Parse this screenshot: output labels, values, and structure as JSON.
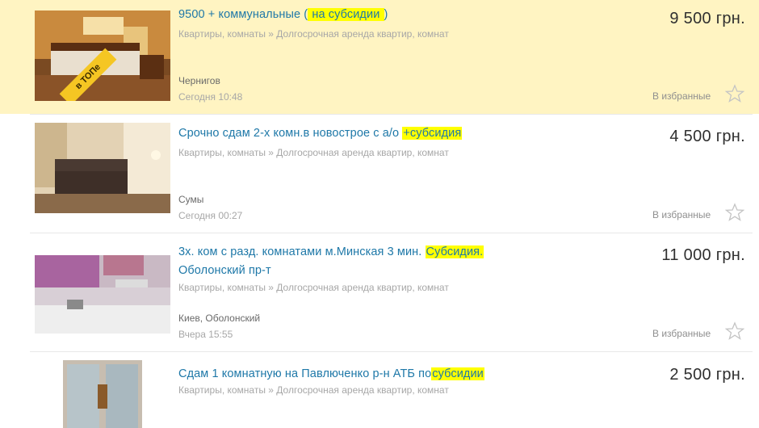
{
  "favorites_label": "В избранные",
  "top_badge": "в ТОПе",
  "colors": {
    "top_background": "#fff4c2",
    "title_link": "#1e78a8",
    "highlight": "#ffff00",
    "muted_text": "#a7a7a7"
  },
  "listings": [
    {
      "title_parts": [
        "9500 + коммунальные (",
        " на субсидии ",
        ")"
      ],
      "category": "Квартиры, комнаты » Долгосрочная аренда квартир, комнат",
      "city": "Чернигов",
      "date": "Сегодня 10:48",
      "price": "9 500 грн.",
      "promoted": true,
      "image_icon": "bedroom-photo"
    },
    {
      "title_parts": [
        "Срочно сдам 2-х комн.в новострое с а/о ",
        "+субсидия",
        ""
      ],
      "category": "Квартиры, комнаты » Долгосрочная аренда квартир, комнат",
      "city": "Сумы",
      "date": "Сегодня 00:27",
      "price": "4 500 грн.",
      "promoted": false,
      "image_icon": "living-room-photo"
    },
    {
      "title_parts": [
        "3х. ком с разд. комнатами м.Минская 3 мин. ",
        "Субсидия.",
        " Оболонский пр-т"
      ],
      "category": "Квартиры, комнаты » Долгосрочная аренда квартир, комнат",
      "city": "Киев, Оболонский",
      "date": "Вчера 15:55",
      "price": "11 000 грн.",
      "promoted": false,
      "image_icon": "kitchen-photo"
    },
    {
      "title_parts": [
        "Сдам 1 комнатную на Павлюченко р-н АТБ по",
        "субсидии ",
        ""
      ],
      "category": "Квартиры, комнаты » Долгосрочная аренда квартир, комнат",
      "price": "2 500 грн.",
      "promoted": false,
      "image_icon": "room-photo"
    }
  ]
}
